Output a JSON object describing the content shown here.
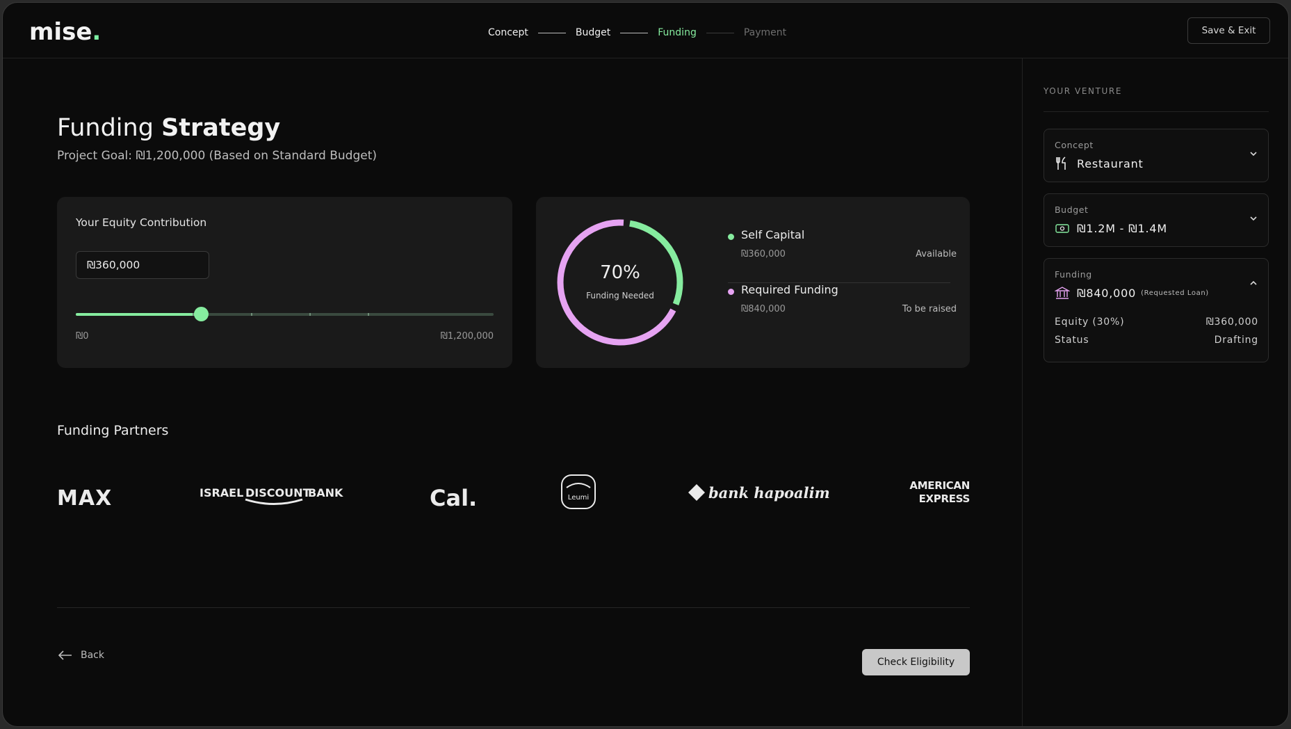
{
  "brand": {
    "name": "mise",
    "dot": "."
  },
  "stepper": {
    "steps": [
      {
        "label": "Concept",
        "state": "done"
      },
      {
        "label": "Budget",
        "state": "done"
      },
      {
        "label": "Funding",
        "state": "active"
      },
      {
        "label": "Payment",
        "state": "todo"
      }
    ]
  },
  "header": {
    "save_exit_label": "Save & Exit"
  },
  "page": {
    "title_light": "Funding",
    "title_bold": "Strategy",
    "subtitle": "Project Goal: ₪1,200,000 (Based on Standard Budget)"
  },
  "equity": {
    "label": "Your Equity Contribution",
    "input_value": "₪360,000",
    "slider_min_label": "₪0",
    "slider_max_label": "₪1,200,000",
    "slider_fraction": 0.3
  },
  "funding_summary": {
    "percent_label": "70%",
    "caption": "Funding Needed",
    "self_fraction": 0.3,
    "legend": [
      {
        "name": "Self Capital",
        "amount": "₪360,000",
        "state": "Available",
        "color": "#86ec9f"
      },
      {
        "name": "Required Funding",
        "amount": "₪840,000",
        "state": "To be raised",
        "color": "#e6a3f2"
      }
    ]
  },
  "partners": {
    "title": "Funding Partners",
    "logos": [
      {
        "name": "MAX"
      },
      {
        "name": "ISRAEL DISCOUNT BANK",
        "parts": [
          "ISRAEL",
          "DISCOUNT",
          "BANK"
        ]
      },
      {
        "name": "Cal."
      },
      {
        "name": "Leumi"
      },
      {
        "name": "bank hapoalim"
      },
      {
        "name": "AMERICAN EXPRESS",
        "parts": [
          "AMERICAN",
          "EXPRESS"
        ]
      }
    ]
  },
  "footer": {
    "back_label": "Back",
    "check_label": "Check Eligibility"
  },
  "sidebar": {
    "heading": "YOUR VENTURE",
    "concept": {
      "label": "Concept",
      "value": "Restaurant",
      "icon": "fork-knife-icon"
    },
    "budget": {
      "label": "Budget",
      "value": "₪1.2M - ₪1.4M",
      "icon": "cash-icon"
    },
    "funding": {
      "label": "Funding",
      "value": "₪840,000",
      "note": "(Requested Loan)",
      "icon": "bank-icon",
      "rows": [
        {
          "key": "Equity (30%)",
          "value": "₪360,000"
        },
        {
          "key": "Status",
          "value": "Drafting"
        }
      ]
    }
  },
  "colors": {
    "accent_green": "#86ec9f",
    "accent_pink": "#e6a3f2",
    "background": "#0b0b0b",
    "card": "#1a1a1a"
  }
}
